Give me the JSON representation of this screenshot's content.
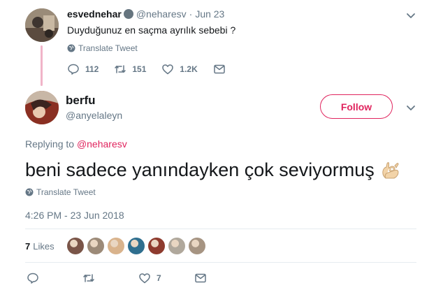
{
  "parent_tweet": {
    "display_name": "esvednehar",
    "handle": "@neharesv",
    "dot": "·",
    "date": "Jun 23",
    "text": "Duyduğunuz en saçma ayrılık sebebi ?",
    "translate_label": "Translate Tweet",
    "replies": "112",
    "retweets": "151",
    "likes": "1.2K"
  },
  "main_tweet": {
    "display_name": "berfu",
    "handle": "@anyelaleyn",
    "follow_label": "Follow",
    "replying_to_label": "Replying to",
    "replying_to_handle": "@neharesv",
    "text": "beni sadece yanındayken çok seviyormuş",
    "translate_label": "Translate Tweet",
    "timestamp": "4:26 PM - 23 Jun 2018",
    "like_count": "7",
    "likes_label": "Likes",
    "action_likes": "7"
  },
  "liker_avatars": [
    "#7a5548",
    "#9c8a78",
    "#d9b38c",
    "#2f6f8f",
    "#8e3b2e",
    "#b0a89c",
    "#a69482"
  ],
  "colors": {
    "accent": "#e0245e",
    "secondary_text": "#657786",
    "thread_line": "#f0b4c8"
  },
  "icons": [
    "verified-badge-icon",
    "globe-icon",
    "reply-icon",
    "retweet-icon",
    "heart-icon",
    "message-icon",
    "chevron-down-icon",
    "ok-hand-emoji-icon"
  ]
}
